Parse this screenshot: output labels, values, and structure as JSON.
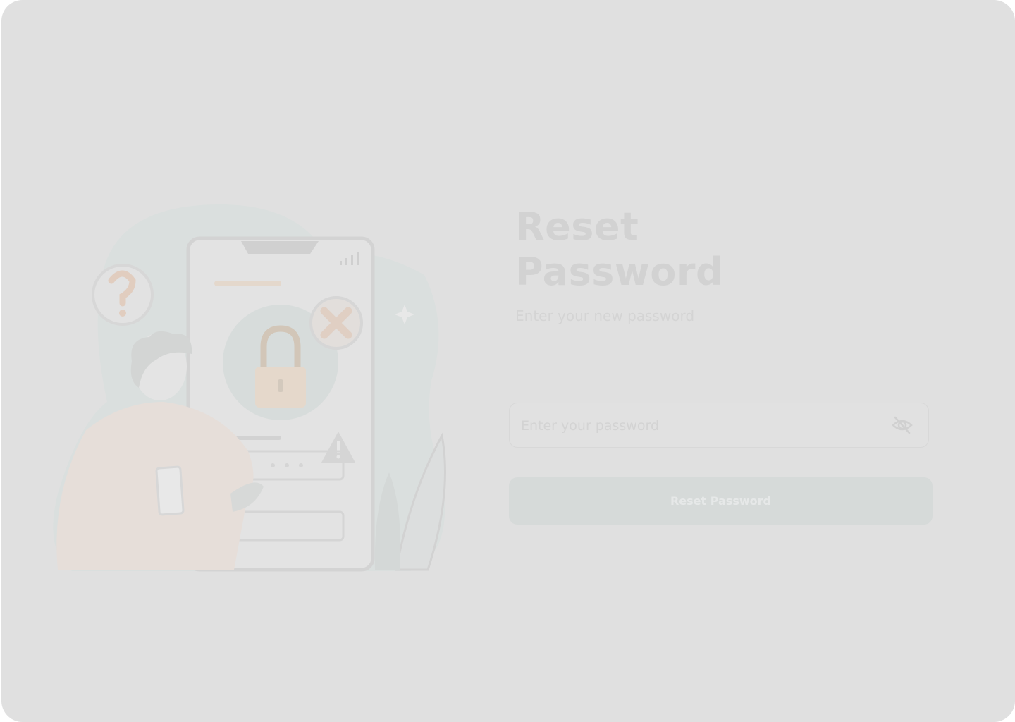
{
  "heading": {
    "title": "Reset\nPassword",
    "subtitle": "Enter your new password"
  },
  "password_field": {
    "placeholder": "Enter your password",
    "value": "",
    "toggle_icon": "eye-off-icon"
  },
  "actions": {
    "submit_label": "Reset Password"
  },
  "colors": {
    "overlay": "#e0e0e0",
    "button": "#d6dad9",
    "title": "#d2d2d2"
  }
}
